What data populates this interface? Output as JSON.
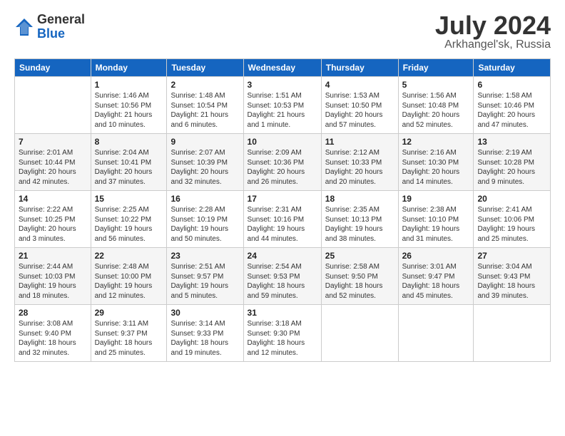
{
  "header": {
    "logo_general": "General",
    "logo_blue": "Blue",
    "month": "July 2024",
    "location": "Arkhangel'sk, Russia"
  },
  "weekdays": [
    "Sunday",
    "Monday",
    "Tuesday",
    "Wednesday",
    "Thursday",
    "Friday",
    "Saturday"
  ],
  "weeks": [
    [
      {
        "day": "",
        "sunrise": "",
        "sunset": "",
        "daylight": ""
      },
      {
        "day": "1",
        "sunrise": "Sunrise: 1:46 AM",
        "sunset": "Sunset: 10:56 PM",
        "daylight": "Daylight: 21 hours and 10 minutes."
      },
      {
        "day": "2",
        "sunrise": "Sunrise: 1:48 AM",
        "sunset": "Sunset: 10:54 PM",
        "daylight": "Daylight: 21 hours and 6 minutes."
      },
      {
        "day": "3",
        "sunrise": "Sunrise: 1:51 AM",
        "sunset": "Sunset: 10:53 PM",
        "daylight": "Daylight: 21 hours and 1 minute."
      },
      {
        "day": "4",
        "sunrise": "Sunrise: 1:53 AM",
        "sunset": "Sunset: 10:50 PM",
        "daylight": "Daylight: 20 hours and 57 minutes."
      },
      {
        "day": "5",
        "sunrise": "Sunrise: 1:56 AM",
        "sunset": "Sunset: 10:48 PM",
        "daylight": "Daylight: 20 hours and 52 minutes."
      },
      {
        "day": "6",
        "sunrise": "Sunrise: 1:58 AM",
        "sunset": "Sunset: 10:46 PM",
        "daylight": "Daylight: 20 hours and 47 minutes."
      }
    ],
    [
      {
        "day": "7",
        "sunrise": "Sunrise: 2:01 AM",
        "sunset": "Sunset: 10:44 PM",
        "daylight": "Daylight: 20 hours and 42 minutes."
      },
      {
        "day": "8",
        "sunrise": "Sunrise: 2:04 AM",
        "sunset": "Sunset: 10:41 PM",
        "daylight": "Daylight: 20 hours and 37 minutes."
      },
      {
        "day": "9",
        "sunrise": "Sunrise: 2:07 AM",
        "sunset": "Sunset: 10:39 PM",
        "daylight": "Daylight: 20 hours and 32 minutes."
      },
      {
        "day": "10",
        "sunrise": "Sunrise: 2:09 AM",
        "sunset": "Sunset: 10:36 PM",
        "daylight": "Daylight: 20 hours and 26 minutes."
      },
      {
        "day": "11",
        "sunrise": "Sunrise: 2:12 AM",
        "sunset": "Sunset: 10:33 PM",
        "daylight": "Daylight: 20 hours and 20 minutes."
      },
      {
        "day": "12",
        "sunrise": "Sunrise: 2:16 AM",
        "sunset": "Sunset: 10:30 PM",
        "daylight": "Daylight: 20 hours and 14 minutes."
      },
      {
        "day": "13",
        "sunrise": "Sunrise: 2:19 AM",
        "sunset": "Sunset: 10:28 PM",
        "daylight": "Daylight: 20 hours and 9 minutes."
      }
    ],
    [
      {
        "day": "14",
        "sunrise": "Sunrise: 2:22 AM",
        "sunset": "Sunset: 10:25 PM",
        "daylight": "Daylight: 20 hours and 3 minutes."
      },
      {
        "day": "15",
        "sunrise": "Sunrise: 2:25 AM",
        "sunset": "Sunset: 10:22 PM",
        "daylight": "Daylight: 19 hours and 56 minutes."
      },
      {
        "day": "16",
        "sunrise": "Sunrise: 2:28 AM",
        "sunset": "Sunset: 10:19 PM",
        "daylight": "Daylight: 19 hours and 50 minutes."
      },
      {
        "day": "17",
        "sunrise": "Sunrise: 2:31 AM",
        "sunset": "Sunset: 10:16 PM",
        "daylight": "Daylight: 19 hours and 44 minutes."
      },
      {
        "day": "18",
        "sunrise": "Sunrise: 2:35 AM",
        "sunset": "Sunset: 10:13 PM",
        "daylight": "Daylight: 19 hours and 38 minutes."
      },
      {
        "day": "19",
        "sunrise": "Sunrise: 2:38 AM",
        "sunset": "Sunset: 10:10 PM",
        "daylight": "Daylight: 19 hours and 31 minutes."
      },
      {
        "day": "20",
        "sunrise": "Sunrise: 2:41 AM",
        "sunset": "Sunset: 10:06 PM",
        "daylight": "Daylight: 19 hours and 25 minutes."
      }
    ],
    [
      {
        "day": "21",
        "sunrise": "Sunrise: 2:44 AM",
        "sunset": "Sunset: 10:03 PM",
        "daylight": "Daylight: 19 hours and 18 minutes."
      },
      {
        "day": "22",
        "sunrise": "Sunrise: 2:48 AM",
        "sunset": "Sunset: 10:00 PM",
        "daylight": "Daylight: 19 hours and 12 minutes."
      },
      {
        "day": "23",
        "sunrise": "Sunrise: 2:51 AM",
        "sunset": "Sunset: 9:57 PM",
        "daylight": "Daylight: 19 hours and 5 minutes."
      },
      {
        "day": "24",
        "sunrise": "Sunrise: 2:54 AM",
        "sunset": "Sunset: 9:53 PM",
        "daylight": "Daylight: 18 hours and 59 minutes."
      },
      {
        "day": "25",
        "sunrise": "Sunrise: 2:58 AM",
        "sunset": "Sunset: 9:50 PM",
        "daylight": "Daylight: 18 hours and 52 minutes."
      },
      {
        "day": "26",
        "sunrise": "Sunrise: 3:01 AM",
        "sunset": "Sunset: 9:47 PM",
        "daylight": "Daylight: 18 hours and 45 minutes."
      },
      {
        "day": "27",
        "sunrise": "Sunrise: 3:04 AM",
        "sunset": "Sunset: 9:43 PM",
        "daylight": "Daylight: 18 hours and 39 minutes."
      }
    ],
    [
      {
        "day": "28",
        "sunrise": "Sunrise: 3:08 AM",
        "sunset": "Sunset: 9:40 PM",
        "daylight": "Daylight: 18 hours and 32 minutes."
      },
      {
        "day": "29",
        "sunrise": "Sunrise: 3:11 AM",
        "sunset": "Sunset: 9:37 PM",
        "daylight": "Daylight: 18 hours and 25 minutes."
      },
      {
        "day": "30",
        "sunrise": "Sunrise: 3:14 AM",
        "sunset": "Sunset: 9:33 PM",
        "daylight": "Daylight: 18 hours and 19 minutes."
      },
      {
        "day": "31",
        "sunrise": "Sunrise: 3:18 AM",
        "sunset": "Sunset: 9:30 PM",
        "daylight": "Daylight: 18 hours and 12 minutes."
      },
      {
        "day": "",
        "sunrise": "",
        "sunset": "",
        "daylight": ""
      },
      {
        "day": "",
        "sunrise": "",
        "sunset": "",
        "daylight": ""
      },
      {
        "day": "",
        "sunrise": "",
        "sunset": "",
        "daylight": ""
      }
    ]
  ]
}
